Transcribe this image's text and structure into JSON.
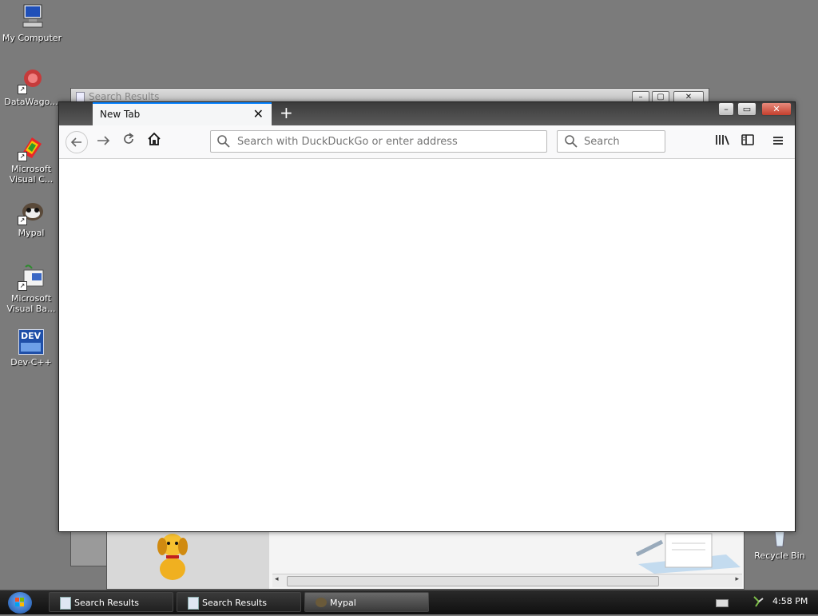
{
  "desktop": {
    "icons": [
      {
        "label_1": "My Computer",
        "label_2": ""
      },
      {
        "label_1": "DataWago...",
        "label_2": ""
      },
      {
        "label_1": "Microsoft",
        "label_2": "Visual C..."
      },
      {
        "label_1": "Mypal",
        "label_2": ""
      },
      {
        "label_1": "Microsoft",
        "label_2": "Visual Ba..."
      },
      {
        "label_1": "Dev-C++",
        "label_2": ""
      },
      {
        "label_1": "Recycle Bin",
        "label_2": ""
      }
    ],
    "dev_icon_text": "DEV"
  },
  "background_window": {
    "title": "Search Results"
  },
  "browser": {
    "tab_title": "New Tab",
    "tab_close": "✕",
    "new_tab_symbol": "+",
    "url_placeholder": "Search with DuckDuckGo or enter address",
    "search_placeholder": "Search",
    "accent_color": "#0a84ff"
  },
  "taskbar": {
    "items": [
      {
        "label": "Search Results"
      },
      {
        "label": "Search Results"
      },
      {
        "label": "Mypal"
      }
    ],
    "clock": "4:58 PM"
  }
}
